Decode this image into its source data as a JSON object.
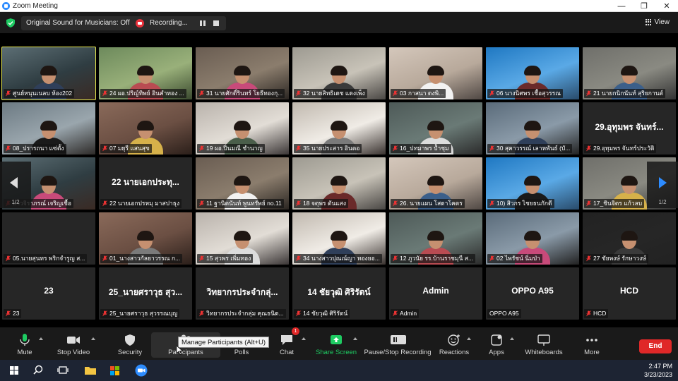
{
  "window": {
    "title": "Zoom Meeting",
    "minimize": "—",
    "maximize": "❐",
    "close": "✕"
  },
  "topbar": {
    "sound_label": "Original Sound for Musicians: Off",
    "recording_label": "Recording...",
    "view_label": "View"
  },
  "grid": {
    "page_left": "1/2",
    "page_right": "1/2",
    "tiles": [
      {
        "label": "ศูนย์หนุนเนลบ ห้อง202",
        "big": "",
        "video": true,
        "active": true
      },
      {
        "label": "24 ผอ.ปริญ์ทิพย์ อินคำทอง ...",
        "big": "",
        "video": true
      },
      {
        "label": "31 นายศักดิ์รินทร์ โยธีทองกุ...",
        "big": "",
        "video": true
      },
      {
        "label": "32 นายสิทธิเดช แดงเพ็ง",
        "big": "",
        "video": true
      },
      {
        "label": "03 กาสนา ดงพิ...",
        "big": "",
        "video": true
      },
      {
        "label": "06 นางนิศพร เชื้อสุวรรณ",
        "big": "",
        "video": true
      },
      {
        "label": "21 นายกนิกนันท์ สุริยกานต์",
        "big": "",
        "video": true
      },
      {
        "label": "08_ปรารถนา แซ่ตั้ง",
        "big": "",
        "video": true
      },
      {
        "label": "07 มยุรี แสนสุข",
        "big": "",
        "video": true
      },
      {
        "label": "19 ผอ.ปิ่นมณี ชำนาญ",
        "big": "",
        "video": true
      },
      {
        "label": "35 นายประสาร อินตอ",
        "big": "",
        "video": true
      },
      {
        "label": "16_ปทมาพร ป้ำชุม",
        "big": "",
        "video": true
      },
      {
        "label": "30 สุคาวรรณ์ เลาหพันธ์ (บั...",
        "big": "",
        "video": true
      },
      {
        "label": "29.อุทุมพร จันทร์ประวัติ",
        "big": "29.อุทุมพร จันทร์...",
        "video": false
      },
      {
        "label": "สาวจิราภรณ์ เจริญเชื้อ",
        "big": "",
        "video": true
      },
      {
        "label": "22 นายเอกปรหมุ มาสปาธุง",
        "big": "22 นายเอกประทุ...",
        "video": false
      },
      {
        "label": "11 ฐานิตนันท์ พูนทรัพย์ no.11",
        "big": "",
        "video": true
      },
      {
        "label": "18 จตุพร ตันแสง",
        "big": "",
        "video": true
      },
      {
        "label": "26. นายแผน โสดาโคตร",
        "big": "",
        "video": true
      },
      {
        "label": "10) สิวกร ไชยธนกักดี",
        "big": "",
        "video": true
      },
      {
        "label": "17_ชินจิตร แก้วลบ",
        "big": "",
        "video": true
      },
      {
        "label": "05.นายสุนทร พริกจำรูญ ส...",
        "big": "",
        "video": false
      },
      {
        "label": "01_นางสาวกัลยาวรรณ ก...",
        "big": "",
        "video": true
      },
      {
        "label": "15 สุวพร เพิ่มทอง",
        "big": "",
        "video": true
      },
      {
        "label": "34 นางสาวปุณณ์ญา ทองยอ...",
        "big": "",
        "video": true
      },
      {
        "label": "12 ภูวนัย รร.บ้านราชมุนี ส...",
        "big": "",
        "video": true
      },
      {
        "label": "02 ไพรัชน์ นิ่มป่า",
        "big": "",
        "video": true
      },
      {
        "label": "27 ชัยพงษ์ รักษาวงษ์",
        "big": "",
        "video": true
      },
      {
        "label": "23",
        "big": "23",
        "video": false
      },
      {
        "label": "25_นายศราวุธ สุวรรณบุญ",
        "big": "25_นายศราวุธ สุว...",
        "video": false
      },
      {
        "label": "วิทยากรประจำกลุ่ม คุณธนิด...",
        "big": "วิทยากรประจำกลุ่...",
        "video": false
      },
      {
        "label": "14 ชัยวุฒิ ศิริรัตน์",
        "big": "14 ชัยวุฒิ ศิริรัตน์",
        "video": false
      },
      {
        "label": "Admin",
        "big": "Admin",
        "video": false
      },
      {
        "label": "OPPO A95",
        "big": "OPPO A95",
        "video": false,
        "nomic": true
      },
      {
        "label": "HCD",
        "big": "HCD",
        "video": false
      }
    ]
  },
  "toolbar": {
    "mute": "Mute",
    "stop_video": "Stop Video",
    "security": "Security",
    "participants": "Participants",
    "polls": "Polls",
    "chat": "Chat",
    "chat_badge": "1",
    "share_screen": "Share Screen",
    "pause_stop_recording": "Pause/Stop Recording",
    "reactions": "Reactions",
    "apps": "Apps",
    "whiteboards": "Whiteboards",
    "more": "More",
    "end": "End",
    "tooltip": "Manage Participants (Alt+U)"
  },
  "taskbar": {
    "time": "2:47 PM",
    "date": "3/23/2023"
  },
  "colors": {
    "accent_green": "#1ecb62",
    "end_red": "#e02828",
    "active_speaker": "#e5e64c",
    "zoom_blue": "#2d8cff"
  }
}
